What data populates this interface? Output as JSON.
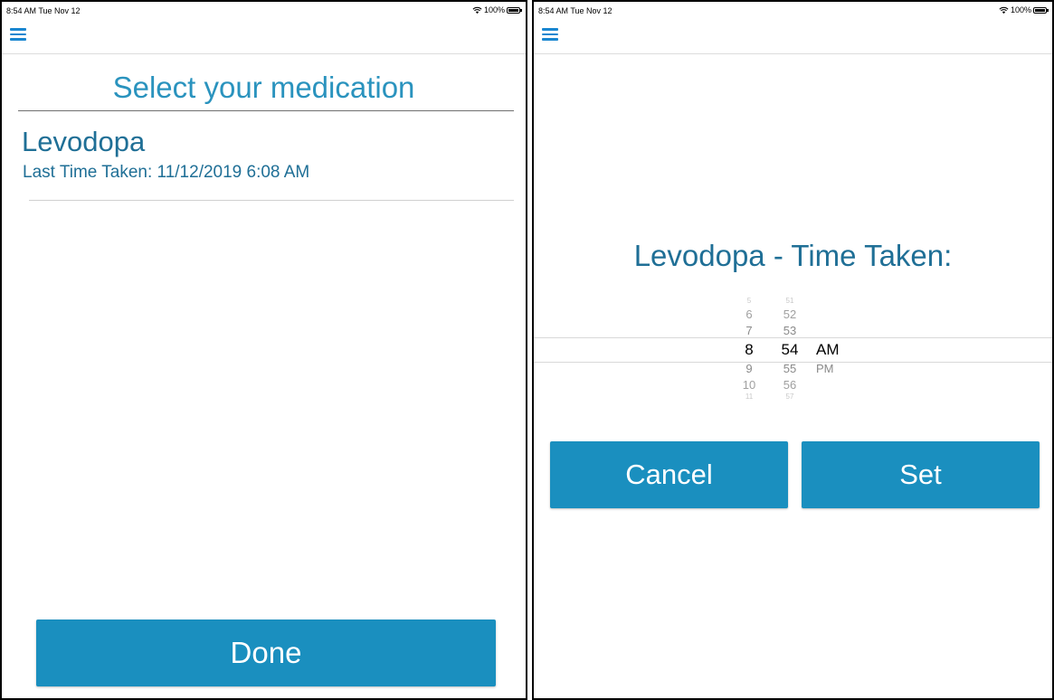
{
  "colors": {
    "accent": "#1a86d0",
    "button_bg": "#1a8fbf",
    "title_text": "#2a93be",
    "body_text": "#1f6f96"
  },
  "left_screen": {
    "status_bar": {
      "time": "8:54 AM  Tue Nov 12",
      "battery": "100%",
      "battery_level": 1.0
    },
    "nav": {
      "menu_icon": "hamburger-menu-icon"
    },
    "title": "Select your medication",
    "medications": [
      {
        "name": "Levodopa",
        "last_taken": "Last Time Taken: 11/12/2019 6:08 AM"
      }
    ],
    "done_button": "Done"
  },
  "right_screen": {
    "status_bar": {
      "time": "8:54 AM  Tue Nov 12",
      "battery": "100%",
      "battery_level": 1.0
    },
    "nav": {
      "menu_icon": "hamburger-menu-icon"
    },
    "picker_title": "Levodopa - Time Taken:",
    "picker": {
      "hours": [
        "5",
        "6",
        "7",
        "8",
        "9",
        "10",
        "11"
      ],
      "minutes": [
        "51",
        "52",
        "53",
        "54",
        "55",
        "56",
        "57"
      ],
      "ampm": [
        "AM",
        "PM"
      ],
      "selected": {
        "hour": "8",
        "minute": "54",
        "ampm": "AM"
      }
    },
    "cancel_button": "Cancel",
    "set_button": "Set"
  }
}
